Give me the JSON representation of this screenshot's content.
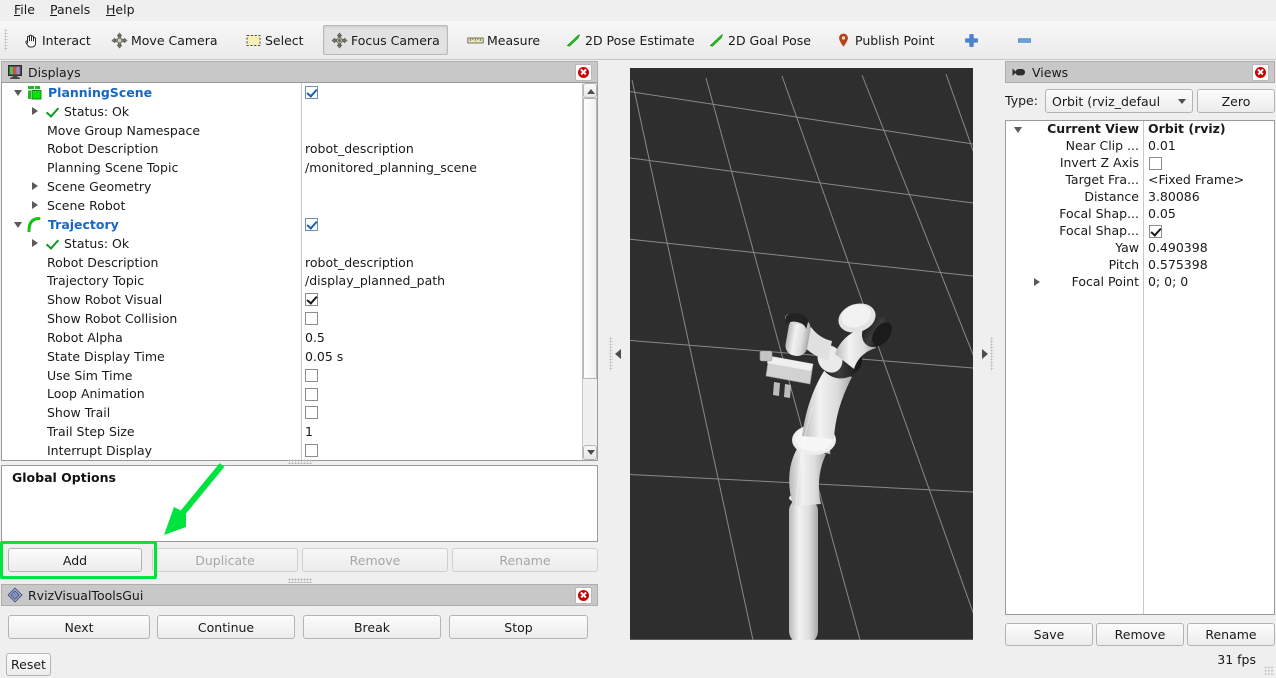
{
  "window": {
    "fps": "31 fps"
  },
  "menubar": {
    "items": [
      {
        "label": "File",
        "mnemonic": "F"
      },
      {
        "label": "Panels",
        "mnemonic": "P"
      },
      {
        "label": "Help",
        "mnemonic": "H"
      }
    ]
  },
  "toolbar": {
    "items": [
      {
        "label": "Interact",
        "icon": "hand-cursor-icon",
        "active": false
      },
      {
        "label": "Move Camera",
        "icon": "move-camera-icon",
        "active": false
      },
      {
        "label": "Select",
        "icon": "select-rectangle-icon",
        "active": false
      },
      {
        "label": "Focus Camera",
        "icon": "focus-camera-icon",
        "active": true
      },
      {
        "label": "Measure",
        "icon": "ruler-icon",
        "active": false
      },
      {
        "label": "2D Pose Estimate",
        "icon": "green-arrow-icon",
        "active": false
      },
      {
        "label": "2D Goal Pose",
        "icon": "green-arrow-icon",
        "active": false
      },
      {
        "label": "Publish Point",
        "icon": "map-pin-icon",
        "active": false
      }
    ],
    "add_tool_label": "+",
    "remove_tool_label": "−",
    "overflow_label": "▾"
  },
  "displays": {
    "title": "Displays",
    "title_icon": "display-monitor-icon",
    "close_icon": "close-icon",
    "tree": [
      {
        "indent": 0,
        "arrow": "down",
        "icon": "planning-scene-icon",
        "label": "PlanningScene",
        "bold": true,
        "value": "",
        "widget": "checkbox-blue-checked"
      },
      {
        "indent": 1,
        "arrow": "right",
        "icon": "ok-check-icon",
        "label": "Status: Ok",
        "bold": false,
        "value": "",
        "widget": "none"
      },
      {
        "indent": 1,
        "arrow": "none",
        "icon": "none",
        "label": "Move Group Namespace",
        "bold": false,
        "value": "",
        "widget": "none"
      },
      {
        "indent": 1,
        "arrow": "none",
        "icon": "none",
        "label": "Robot Description",
        "bold": false,
        "value": "robot_description",
        "widget": "none"
      },
      {
        "indent": 1,
        "arrow": "none",
        "icon": "none",
        "label": "Planning Scene Topic",
        "bold": false,
        "value": "/monitored_planning_scene",
        "widget": "none"
      },
      {
        "indent": 1,
        "arrow": "right",
        "icon": "none",
        "label": "Scene Geometry",
        "bold": false,
        "value": "",
        "widget": "none"
      },
      {
        "indent": 1,
        "arrow": "right",
        "icon": "none",
        "label": "Scene Robot",
        "bold": false,
        "value": "",
        "widget": "none"
      },
      {
        "indent": 0,
        "arrow": "down",
        "icon": "trajectory-icon",
        "label": "Trajectory",
        "bold": true,
        "value": "",
        "widget": "checkbox-blue-checked"
      },
      {
        "indent": 1,
        "arrow": "right",
        "icon": "ok-check-icon",
        "label": "Status: Ok",
        "bold": false,
        "value": "",
        "widget": "none"
      },
      {
        "indent": 1,
        "arrow": "none",
        "icon": "none",
        "label": "Robot Description",
        "bold": false,
        "value": "robot_description",
        "widget": "none"
      },
      {
        "indent": 1,
        "arrow": "none",
        "icon": "none",
        "label": "Trajectory Topic",
        "bold": false,
        "value": "/display_planned_path",
        "widget": "none"
      },
      {
        "indent": 1,
        "arrow": "none",
        "icon": "none",
        "label": "Show Robot Visual",
        "bold": false,
        "value": "",
        "widget": "checkbox-checked"
      },
      {
        "indent": 1,
        "arrow": "none",
        "icon": "none",
        "label": "Show Robot Collision",
        "bold": false,
        "value": "",
        "widget": "checkbox-unchecked"
      },
      {
        "indent": 1,
        "arrow": "none",
        "icon": "none",
        "label": "Robot Alpha",
        "bold": false,
        "value": "0.5",
        "widget": "none"
      },
      {
        "indent": 1,
        "arrow": "none",
        "icon": "none",
        "label": "State Display Time",
        "bold": false,
        "value": "0.05 s",
        "widget": "none"
      },
      {
        "indent": 1,
        "arrow": "none",
        "icon": "none",
        "label": "Use Sim Time",
        "bold": false,
        "value": "",
        "widget": "checkbox-unchecked"
      },
      {
        "indent": 1,
        "arrow": "none",
        "icon": "none",
        "label": "Loop Animation",
        "bold": false,
        "value": "",
        "widget": "checkbox-unchecked"
      },
      {
        "indent": 1,
        "arrow": "none",
        "icon": "none",
        "label": "Show Trail",
        "bold": false,
        "value": "",
        "widget": "checkbox-unchecked"
      },
      {
        "indent": 1,
        "arrow": "none",
        "icon": "none",
        "label": "Trail Step Size",
        "bold": false,
        "value": "1",
        "widget": "none"
      },
      {
        "indent": 1,
        "arrow": "none",
        "icon": "none",
        "label": "Interrupt Display",
        "bold": false,
        "value": "",
        "widget": "checkbox-unchecked"
      }
    ],
    "global_options_label": "Global Options",
    "buttons": [
      {
        "label": "Add",
        "enabled": true,
        "highlighted": true
      },
      {
        "label": "Duplicate",
        "enabled": false,
        "highlighted": false
      },
      {
        "label": "Remove",
        "enabled": false,
        "highlighted": false
      },
      {
        "label": "Rename",
        "enabled": false,
        "highlighted": false
      }
    ]
  },
  "rviz_visual_tools": {
    "title": "RvizVisualToolsGui",
    "title_icon": "diamond-icon",
    "close_icon": "close-icon",
    "buttons": [
      {
        "label": "Next"
      },
      {
        "label": "Continue"
      },
      {
        "label": "Break"
      },
      {
        "label": "Stop"
      }
    ],
    "reset_label": "Reset"
  },
  "views": {
    "title": "Views",
    "title_icon": "camera-icon",
    "close_icon": "close-icon",
    "type_label": "Type:",
    "type_value": "Orbit (rviz_defaul",
    "zero_label": "Zero",
    "tree": [
      {
        "indent": 0,
        "arrow": "down",
        "label": "Current View",
        "bold": true,
        "value": "Orbit (rviz)",
        "value_bold": true,
        "widget": "none"
      },
      {
        "indent": 1,
        "arrow": "none",
        "label": "Near Clip ...",
        "bold": false,
        "value": "0.01",
        "value_bold": false,
        "widget": "none"
      },
      {
        "indent": 1,
        "arrow": "none",
        "label": "Invert Z Axis",
        "bold": false,
        "value": "",
        "value_bold": false,
        "widget": "checkbox-unchecked"
      },
      {
        "indent": 1,
        "arrow": "none",
        "label": "Target Fra...",
        "bold": false,
        "value": "<Fixed Frame>",
        "value_bold": false,
        "widget": "none"
      },
      {
        "indent": 1,
        "arrow": "none",
        "label": "Distance",
        "bold": false,
        "value": "3.80086",
        "value_bold": false,
        "widget": "none"
      },
      {
        "indent": 1,
        "arrow": "none",
        "label": "Focal Shap...",
        "bold": false,
        "value": "0.05",
        "value_bold": false,
        "widget": "none"
      },
      {
        "indent": 1,
        "arrow": "none",
        "label": "Focal Shap...",
        "bold": false,
        "value": "",
        "value_bold": false,
        "widget": "checkbox-checked"
      },
      {
        "indent": 1,
        "arrow": "none",
        "label": "Yaw",
        "bold": false,
        "value": "0.490398",
        "value_bold": false,
        "widget": "none"
      },
      {
        "indent": 1,
        "arrow": "none",
        "label": "Pitch",
        "bold": false,
        "value": "0.575398",
        "value_bold": false,
        "widget": "none"
      },
      {
        "indent": 1,
        "arrow": "right",
        "label": "Focal Point",
        "bold": false,
        "value": "0; 0; 0",
        "value_bold": false,
        "widget": "none"
      }
    ],
    "buttons": [
      {
        "label": "Save"
      },
      {
        "label": "Remove"
      },
      {
        "label": "Rename"
      }
    ]
  },
  "viewport": {
    "background_color": "#2e2e2e",
    "grid_color": "#8c8c8c",
    "robot_color": "#e8e8e8",
    "description": "3D render view with perspective ground grid and white 7-DOF robot arm"
  },
  "annotation": {
    "arrow_color": "#00e23c",
    "highlight_color": "#00e23c",
    "target": "Add"
  }
}
